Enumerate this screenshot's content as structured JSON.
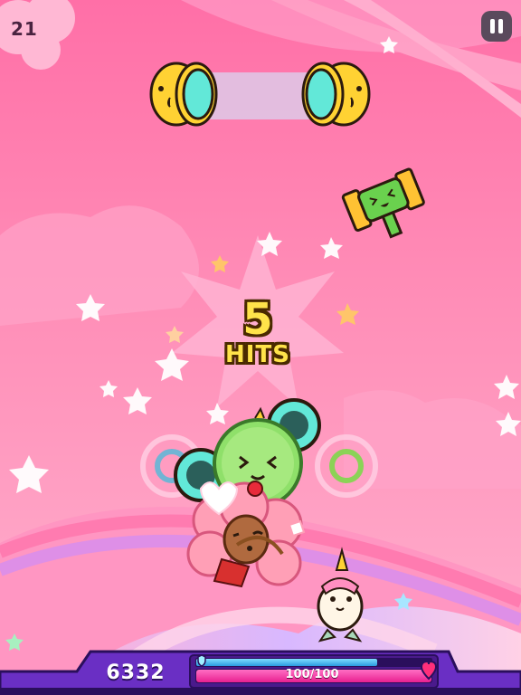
{
  "hud": {
    "top_counter": "21",
    "score": "6332",
    "health_text": "100/100",
    "health": {
      "current": 100,
      "max": 100
    }
  },
  "combo": {
    "count": "5",
    "label": "HITS"
  },
  "colors": {
    "sky": "#ff7fb0",
    "combo_text": "#ffe34a",
    "hud_bar": "#6a2fc4",
    "health_fill": "#ff3aa8",
    "shield_fill": "#42b9ff"
  },
  "icons": {
    "pause": "pause-icon",
    "heart": "heart-icon",
    "shield": "shield-icon"
  }
}
